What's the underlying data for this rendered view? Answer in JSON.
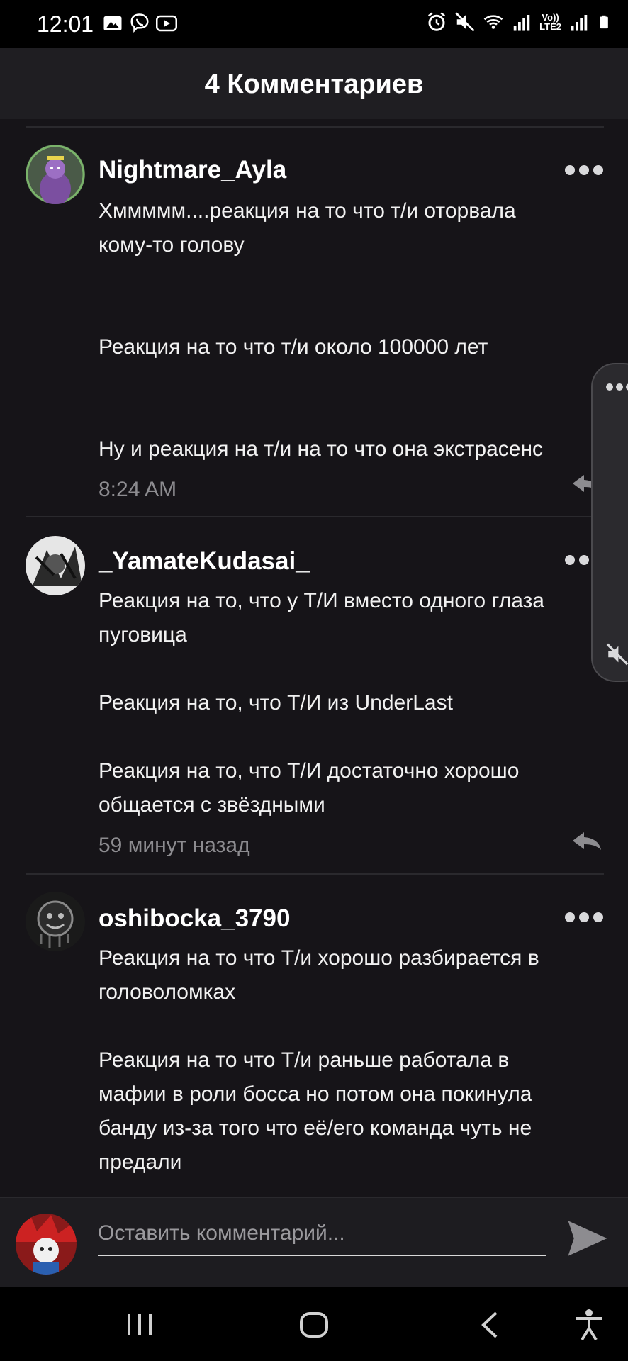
{
  "status_bar": {
    "time": "12:01",
    "left_icons": [
      "gallery-icon",
      "viber-icon",
      "youtube-icon"
    ],
    "right_icons": [
      "alarm-icon",
      "mute-icon",
      "wifi-icon",
      "signal-icon",
      "volte-icon",
      "signal-icon",
      "battery-icon"
    ],
    "lte_top": "Vo))",
    "lte_bottom": "LTE2"
  },
  "header": {
    "title": "4 Комментариев"
  },
  "comments": [
    {
      "username": "Nightmare_Ayla",
      "lines": [
        "Хммммм....реакция на то что т/и оторвала",
        "кому-то голову",
        "",
        "",
        "Реакция на то что т/и около 100000 лет",
        "",
        "",
        "Ну и реакция на т/и на то что она экстрасенс"
      ],
      "time": "8:24 AM"
    },
    {
      "username": "_YamateKudasai_",
      "lines": [
        "Реакция на то, что у Т/И вместо одного глаза",
        "пуговица",
        "",
        "Реакция на то, что Т/И из UnderLast",
        "",
        "Реакция на то, что Т/И достаточно хорошо",
        "общается с звёздными"
      ],
      "time": "59 минут назад"
    },
    {
      "username": "oshibocka_3790",
      "lines": [
        "Реакция на то что Т/и хорошо разбирается в",
        "головоломках",
        "",
        "Реакция на то что Т/и раньше работала в",
        "мафии в роли босса но потом она покинула",
        "банду из-за того что её/его команда чуть не",
        "предали"
      ],
      "time": ""
    }
  ],
  "composer": {
    "placeholder": "Оставить комментарий..."
  },
  "colors": {
    "background": "#161418",
    "header": "#1f1e22",
    "muted_text": "#8d8c90",
    "accent": "#ffffff"
  }
}
